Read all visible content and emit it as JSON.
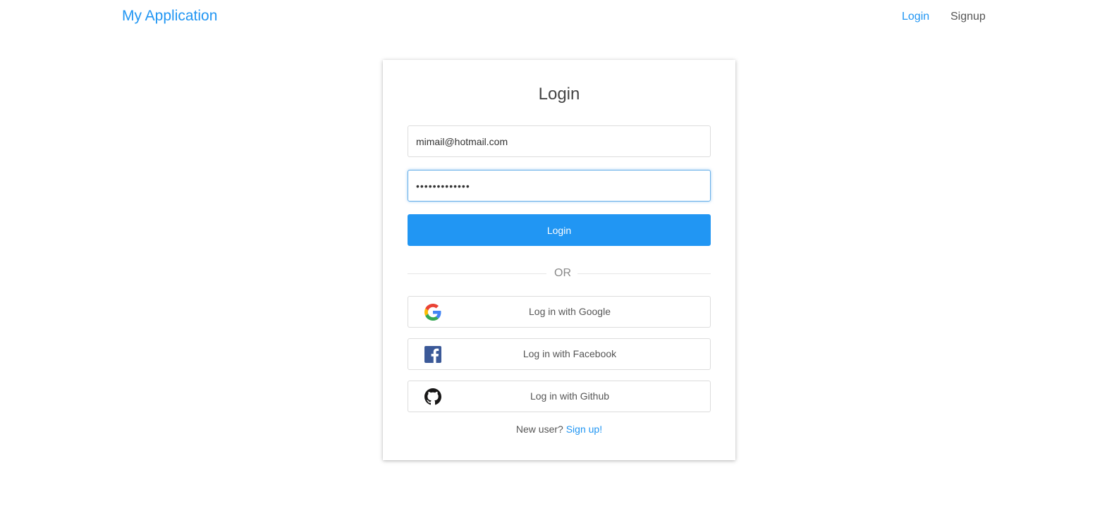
{
  "nav": {
    "brand": "My Application",
    "links": [
      {
        "label": "Login",
        "active": true
      },
      {
        "label": "Signup",
        "active": false
      }
    ]
  },
  "login_card": {
    "title": "Login",
    "email_value": "mimail@hotmail.com",
    "password_masked": "•••••••••••••",
    "submit_label": "Login",
    "divider_text": "OR",
    "social": [
      {
        "label": "Log in with Google",
        "icon": "google-icon"
      },
      {
        "label": "Log in with Facebook",
        "icon": "facebook-icon"
      },
      {
        "label": "Log in with Github",
        "icon": "github-icon"
      }
    ],
    "new_user_text": "New user?",
    "signup_link": "Sign up!"
  },
  "colors": {
    "accent": "#2196f3",
    "focus_border": "#66afe9",
    "facebook": "#3b5998",
    "github": "#181717"
  }
}
